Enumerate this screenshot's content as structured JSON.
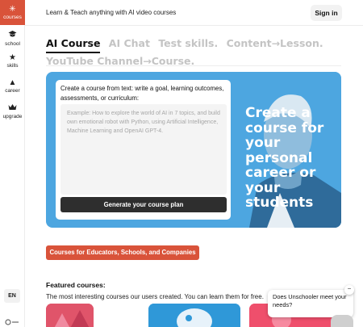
{
  "sidebar": {
    "items": [
      {
        "label": "courses",
        "icon": "sparkle-icon"
      },
      {
        "label": "school",
        "icon": "graduation-cap-icon"
      },
      {
        "label": "skills",
        "icon": "star-icon"
      },
      {
        "label": "career",
        "icon": "triangle-up-icon"
      },
      {
        "label": "upgrade",
        "icon": "crown-icon"
      }
    ],
    "language": "EN",
    "active_color": "#d9533a"
  },
  "header": {
    "tagline": "Learn & Teach anything with AI video courses",
    "signin_label": "Sign in"
  },
  "tabs": [
    {
      "label": "AI Course",
      "active": true
    },
    {
      "label": "AI Chat"
    },
    {
      "label": "Test skills."
    },
    {
      "label": "Content→Lesson."
    },
    {
      "label": "YouTube Channel→Course."
    }
  ],
  "hero": {
    "headline": "Create a course for your personal career or your students",
    "background_color": "#4da6e0",
    "form": {
      "label": "Create a course from text: write a goal, learning outcomes, assessments, or curriculum:",
      "placeholder": "Example: How to explore the world of AI in 7 topics, and build own emotional robot with Python, using Artificial Intelligence, Machine Learning and OpenAI GPT-4.",
      "button_label": "Generate your course plan"
    }
  },
  "cta": {
    "label": "Courses for Educators, Schools, and Companies",
    "color": "#d9533a"
  },
  "featured": {
    "title": "Featured courses:",
    "subtitle": "The most interesting courses our users created. You can learn them for free."
  },
  "chat": {
    "message": "Does Unschooler meet your needs?",
    "close_icon": "minus-icon"
  }
}
